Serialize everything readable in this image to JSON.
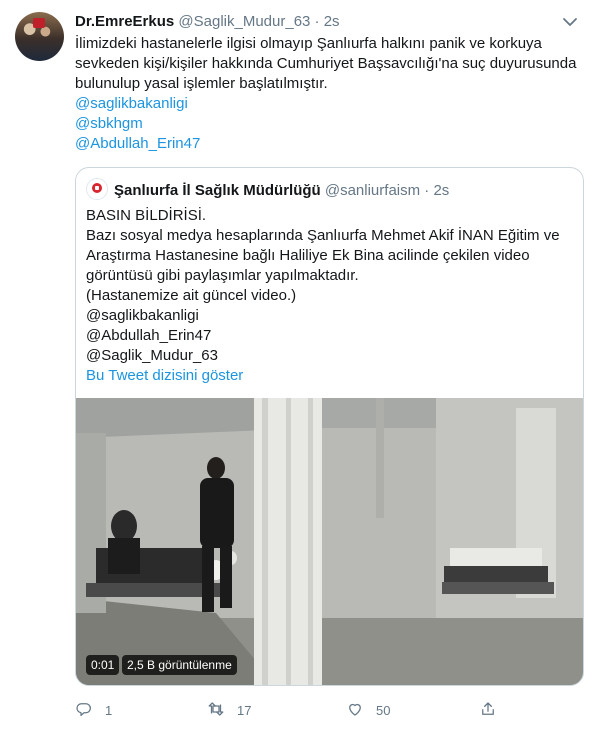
{
  "tweet": {
    "author_name": "Dr.EmreErkus",
    "author_handle": "@Saglik_Mudur_63",
    "separator": "·",
    "time": "2s",
    "text_lines": [
      "İlimizdeki hastanelerle ilgisi olmayıp Şanlıurfa halkını panik ve korkuya",
      "sevkeden kişi/kişiler hakkında Cumhuriyet Başsavcılığı'na suç duyurusunda",
      "bulunulup yasal işlemler başlatılmıştır."
    ],
    "mentions": [
      "@saglikbakanligi",
      "@sbkhgm",
      "@Abdullah_Erin47"
    ]
  },
  "quoted": {
    "author_name": "Şanlıurfa İl Sağlık Müdürlüğü",
    "author_handle": "@sanliurfaism",
    "separator": "·",
    "time": "2s",
    "text_lines": [
      "BASIN BİLDİRİSİ.",
      "Bazı sosyal medya hesaplarında Şanlıurfa Mehmet Akif İNAN Eğitim ve",
      "Araştırma Hastanesine bağlı Haliliye Ek Bina acilinde çekilen video",
      "görüntüsü gibi paylaşımlar yapılmaktadır.",
      "(Hastanemize ait güncel video.)",
      "@saglikbakanligi",
      "@Abdullah_Erin47",
      "@Saglik_Mudur_63"
    ],
    "show_thread": "Bu Tweet dizisini göster",
    "video": {
      "duration": "0:01",
      "views": "2,5 B görüntülenme"
    }
  },
  "actions": {
    "reply_count": "1",
    "retweet_count": "17",
    "like_count": "50"
  },
  "icons": {
    "caret": "chevron-down-icon",
    "reply": "reply-icon",
    "retweet": "retweet-icon",
    "like": "heart-icon",
    "share": "share-icon"
  },
  "colors": {
    "link": "#1b95e0",
    "muted": "#657786",
    "text": "#14171a",
    "border": "#ccd6dd"
  }
}
